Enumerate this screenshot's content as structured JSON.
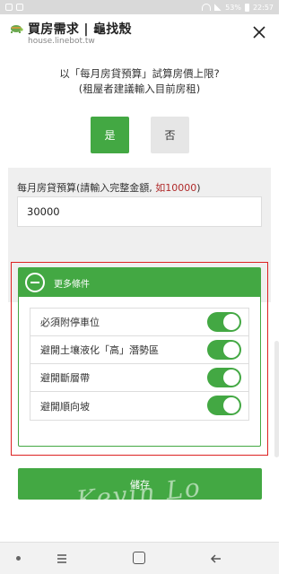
{
  "status_bar": {
    "battery": "53%",
    "time": "22:57"
  },
  "header": {
    "title": "買房需求 | 龜找殼",
    "url": "house.linebot.tw",
    "close_icon": "close-icon"
  },
  "question": {
    "line1": "以「每月房貸預算」試算房價上限?",
    "line2": "(租屋者建議輸入目前房租)"
  },
  "choices": {
    "yes_label": "是",
    "no_label": "否",
    "selected": "是"
  },
  "budget": {
    "label": "每月房貸預算(請輸入完整金額, ",
    "example": "如10000",
    "label_end": ")",
    "value": "30000"
  },
  "more_conditions": {
    "label": "更多條件",
    "options": [
      {
        "label": "必須附停車位",
        "on": true
      },
      {
        "label": "避開土壤液化「高」潛勢區",
        "on": true
      },
      {
        "label": "避開斷層帶",
        "on": true
      },
      {
        "label": "避開順向坡",
        "on": true
      }
    ]
  },
  "submit_label": "儲存",
  "watermark": "Kevin Lo",
  "colors": {
    "accent": "#43a843",
    "highlight_border": "#dd2222",
    "example_text": "#b02a2a"
  }
}
